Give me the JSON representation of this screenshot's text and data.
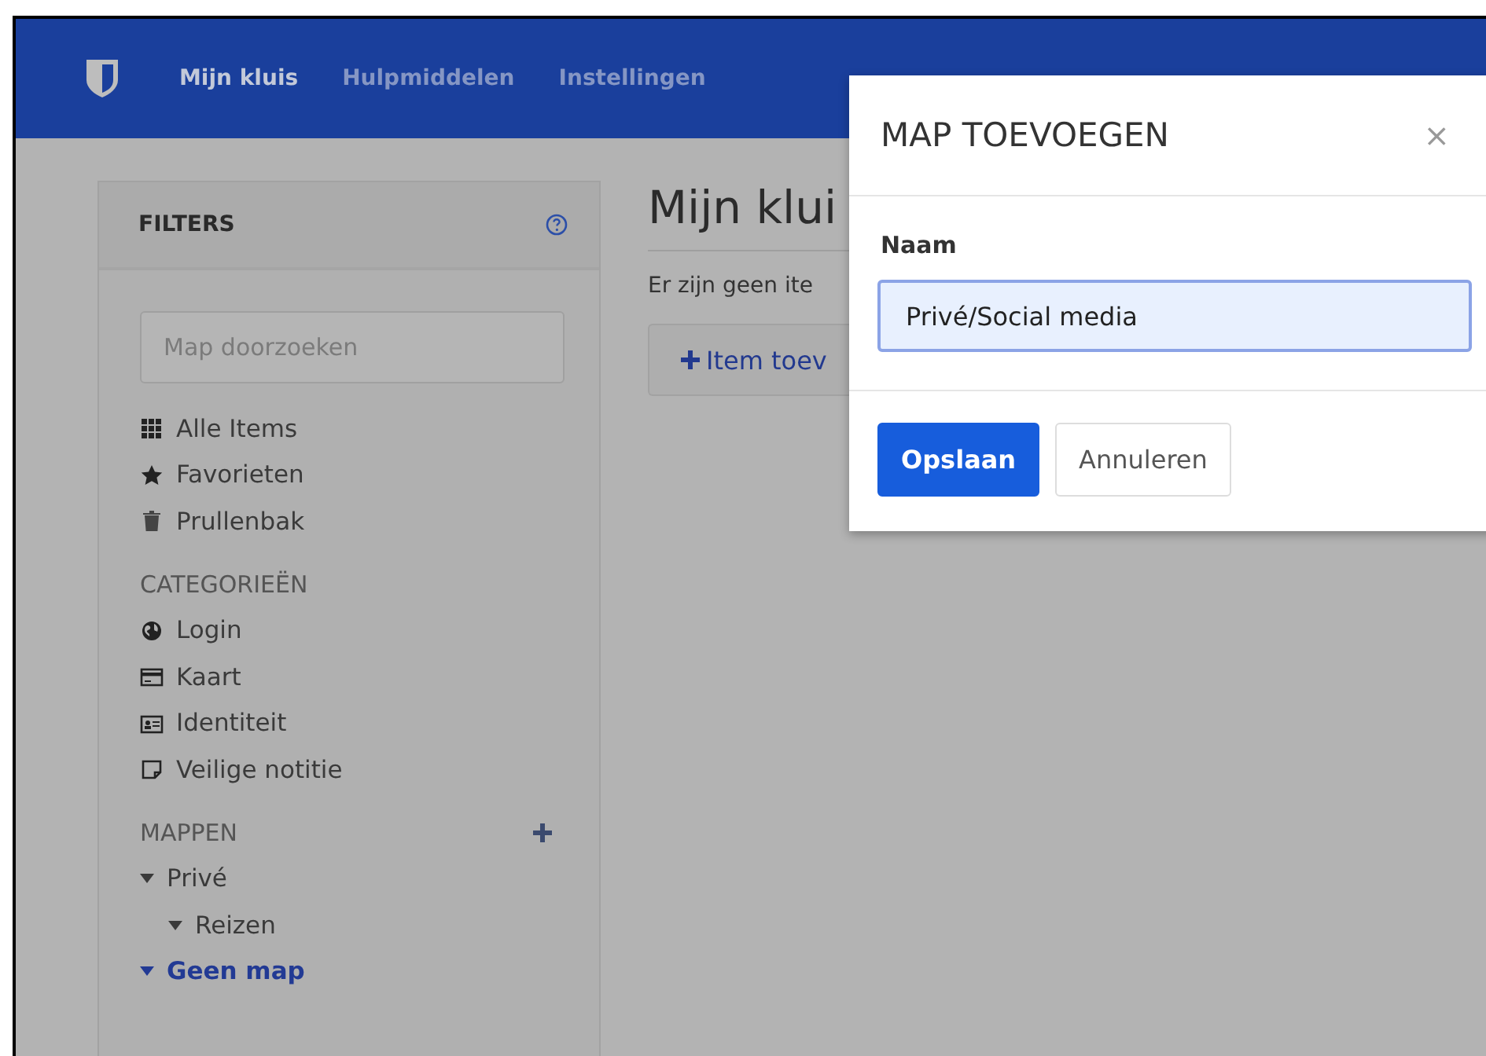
{
  "nav": {
    "items": [
      {
        "label": "Mijn kluis",
        "selected": true
      },
      {
        "label": "Hulpmiddelen",
        "selected": false
      },
      {
        "label": "Instellingen",
        "selected": false
      }
    ]
  },
  "sidebar": {
    "title": "FILTERS",
    "search": {
      "placeholder": "Map doorzoeken"
    },
    "items": [
      {
        "label": "Alle Items",
        "kind": "grid",
        "selected": false
      },
      {
        "label": "Favorieten",
        "kind": "star",
        "selected": false
      },
      {
        "label": "Prullenbak",
        "kind": "trash",
        "selected": false
      }
    ],
    "categories_title": "CATEGORIEËN",
    "categories": [
      {
        "label": "Login",
        "kind": "globe",
        "selected": false
      },
      {
        "label": "Kaart",
        "kind": "card",
        "selected": false
      },
      {
        "label": "Identiteit",
        "kind": "id",
        "selected": false
      },
      {
        "label": "Veilige notitie",
        "kind": "note",
        "selected": false
      }
    ],
    "folders_title": "MAPPEN",
    "folders": [
      {
        "label": "Privé",
        "expanded": true,
        "selected": false,
        "children": [
          {
            "label": "Reizen",
            "expanded": true,
            "selected": false
          }
        ]
      },
      {
        "label": "Geen map",
        "expanded": true,
        "selected": true
      }
    ]
  },
  "main": {
    "title": "Mijn klui",
    "empty_text": "Er zijn geen ite",
    "add_button": "Item toev"
  },
  "dialog": {
    "title": "MAP TOEVOEGEN",
    "close": "×",
    "field_label": "Naam",
    "field_value": "Privé/Social media",
    "buttons": [
      {
        "label": "Opslaan",
        "kind": "primary"
      },
      {
        "label": "Annuleren",
        "kind": "default"
      }
    ]
  }
}
